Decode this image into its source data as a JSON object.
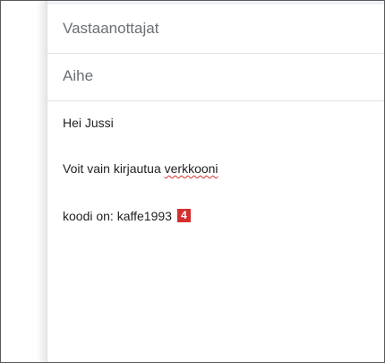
{
  "compose": {
    "recipients": {
      "placeholder": "Vastaanottajat",
      "value": ""
    },
    "subject": {
      "placeholder": "Aihe",
      "value": ""
    },
    "body": {
      "line1": "Hei Jussi",
      "line2_before": "Voit vain kirjautua ",
      "line2_misspelled": "verkkooni",
      "line3": "koodi on: kaffe1993"
    }
  },
  "annotation": {
    "badge_number": "4",
    "badge_color": "#d32f2f",
    "spellcheck_underline_color": "#d93025"
  }
}
